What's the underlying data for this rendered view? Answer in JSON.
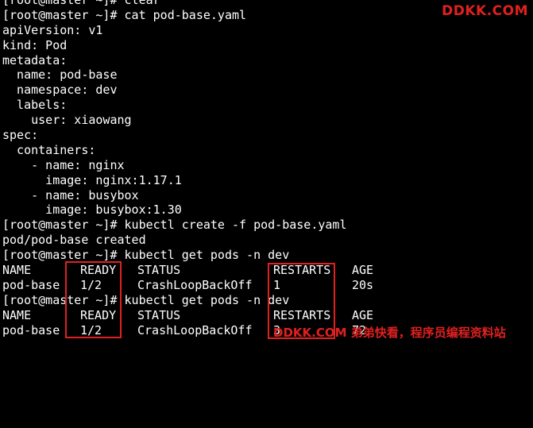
{
  "terminal": {
    "lines": [
      "[root@master ~]# clear",
      "[root@master ~]# cat pod-base.yaml",
      "apiVersion: v1",
      "kind: Pod",
      "metadata:",
      "  name: pod-base",
      "  namespace: dev",
      "  labels:",
      "    user: xiaowang",
      "spec:",
      "  containers:",
      "    - name: nginx",
      "      image: nginx:1.17.1",
      "    - name: busybox",
      "      image: busybox:1.30",
      "[root@master ~]# kubectl create -f pod-base.yaml",
      "pod/pod-base created",
      "[root@master ~]# kubectl get pods -n dev"
    ],
    "table1": {
      "headers": [
        "NAME",
        "READY",
        "STATUS",
        "RESTARTS",
        "AGE"
      ],
      "row": [
        "pod-base",
        "1/2",
        "CrashLoopBackOff",
        "1",
        "20s"
      ]
    },
    "prompt2": "[root@master ~]# kubectl get pods -n dev",
    "table2": {
      "headers": [
        "NAME",
        "READY",
        "STATUS",
        "RESTARTS",
        "AGE"
      ],
      "row": [
        "pod-base",
        "1/2",
        "CrashLoopBackOff",
        "3",
        "72"
      ]
    }
  },
  "watermarks": {
    "top": "DDKK.COM",
    "bottom": "DDKK.COM 弟弟快看，程序员编程资料站"
  },
  "colors": {
    "background": "#000000",
    "text": "#ffffff",
    "highlight": "#e02020"
  }
}
